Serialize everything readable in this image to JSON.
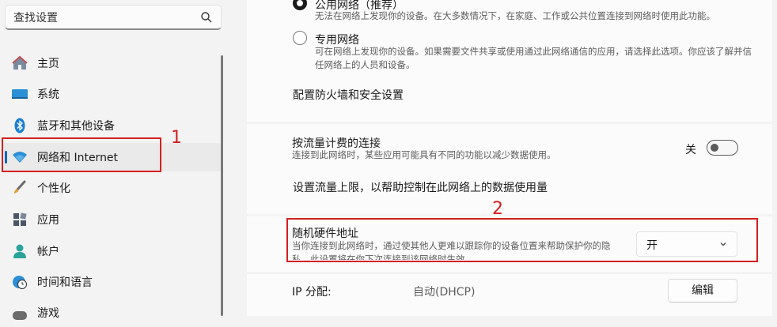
{
  "search": {
    "placeholder": "查找设置"
  },
  "nav": {
    "items": [
      {
        "label": "主页",
        "icon": "home-icon"
      },
      {
        "label": "系统",
        "icon": "system-icon"
      },
      {
        "label": "蓝牙和其他设备",
        "icon": "bluetooth-icon"
      },
      {
        "label": "网络和 Internet",
        "icon": "wifi-icon",
        "selected": true
      },
      {
        "label": "个性化",
        "icon": "brush-icon"
      },
      {
        "label": "应用",
        "icon": "apps-icon"
      },
      {
        "label": "帐户",
        "icon": "person-icon"
      },
      {
        "label": "时间和语言",
        "icon": "clock-globe-icon"
      },
      {
        "label": "游戏",
        "icon": "gamepad-icon"
      }
    ]
  },
  "annotations": {
    "label_1": "1",
    "label_2": "2",
    "color": "#d32020"
  },
  "network_profile": {
    "public": {
      "title": "公用网络（推荐）",
      "desc": "无法在网络上发现你的设备。在大多数情况下，在家庭、工作或公共位置连接到网络时使用此功能。",
      "checked": true
    },
    "private": {
      "title": "专用网络",
      "desc": "可在网络上发现你的设备。如果需要文件共享或使用通过此网络通信的应用，请选择此选项。你应该了解并信任网络上的人员和设备。",
      "checked": false
    },
    "firewall_link": "配置防火墙和安全设置"
  },
  "metered": {
    "title": "按流量计费的连接",
    "desc": "连接到此网络时，某些应用可能具有不同的功能以减少数据使用。",
    "toggle_label": "关",
    "toggle_on": false,
    "data_limit_link": "设置流量上限，以帮助控制在此网络上的数据使用量"
  },
  "random_hw": {
    "title": "随机硬件地址",
    "desc": "当你连接到此网络时，通过使其他人更难以跟踪你的设备位置来帮助保护你的隐私。此设置将在你下次连接到该网络时生效。",
    "value": "开"
  },
  "ip": {
    "label": "IP 分配:",
    "value": "自动(DHCP)",
    "button": "编辑"
  },
  "colors": {
    "accent": "#0067c0"
  }
}
